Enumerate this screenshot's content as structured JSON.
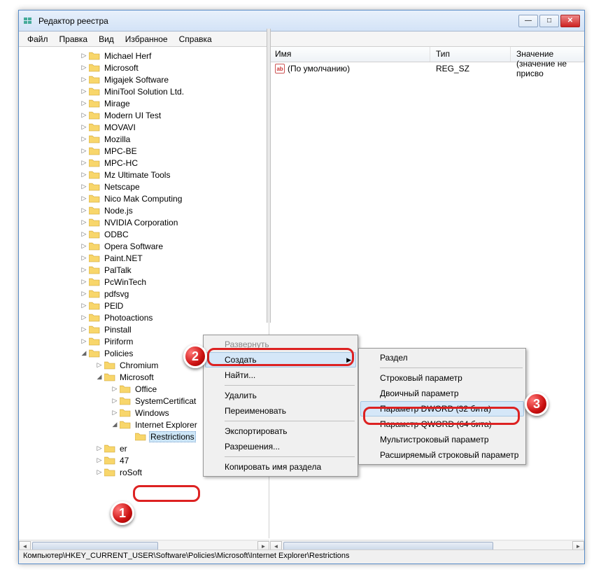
{
  "window": {
    "title": "Редактор реестра"
  },
  "menubar": {
    "file": "Файл",
    "edit": "Правка",
    "view": "Вид",
    "favorites": "Избранное",
    "help": "Справка"
  },
  "tree": {
    "items": [
      "Michael Herf",
      "Microsoft",
      "Migajek Software",
      "MiniTool Solution Ltd.",
      "Mirage",
      "Modern UI Test",
      "MOVAVI",
      "Mozilla",
      "MPC-BE",
      "MPC-HC",
      "Mz Ultimate Tools",
      "Netscape",
      "Nico Mak Computing",
      "Node.js",
      "NVIDIA Corporation",
      "ODBC",
      "Opera Software",
      "Paint.NET",
      "PalTalk",
      "PcWinTech",
      "pdfsvg",
      "PElD",
      "Photoactions",
      "Pinstall",
      "Piriform"
    ],
    "policies": "Policies",
    "policies_children": [
      "Chromium",
      "Microsoft"
    ],
    "ms_children": [
      "Office",
      "SystemCertificat",
      "Windows",
      "Internet Explorer"
    ],
    "restrictions": "Restrictions",
    "tail": [
      "er",
      "47",
      "roSoft"
    ]
  },
  "list": {
    "cols": {
      "name": "Имя",
      "type": "Тип",
      "value": "Значение"
    },
    "row": {
      "name": "(По умолчанию)",
      "type": "REG_SZ",
      "value": "(значение не присво"
    }
  },
  "ctx1": {
    "expand": "Развернуть",
    "create": "Создать",
    "find": "Найти...",
    "delete": "Удалить",
    "rename": "Переименовать",
    "export": "Экспортировать",
    "permissions": "Разрешения...",
    "copyname": "Копировать имя раздела"
  },
  "ctx2": {
    "key": "Раздел",
    "string": "Строковый параметр",
    "binary": "Двоичный параметр",
    "dword": "Параметр DWORD (32 бита)",
    "qword": "Параметр QWORD (64 бита)",
    "multi": "Мультистроковый параметр",
    "expand": "Расширяемый строковый параметр"
  },
  "status": "Компьютер\\HKEY_CURRENT_USER\\Software\\Policies\\Microsoft\\Internet Explorer\\Restrictions",
  "badges": {
    "b1": "1",
    "b2": "2",
    "b3": "3"
  }
}
